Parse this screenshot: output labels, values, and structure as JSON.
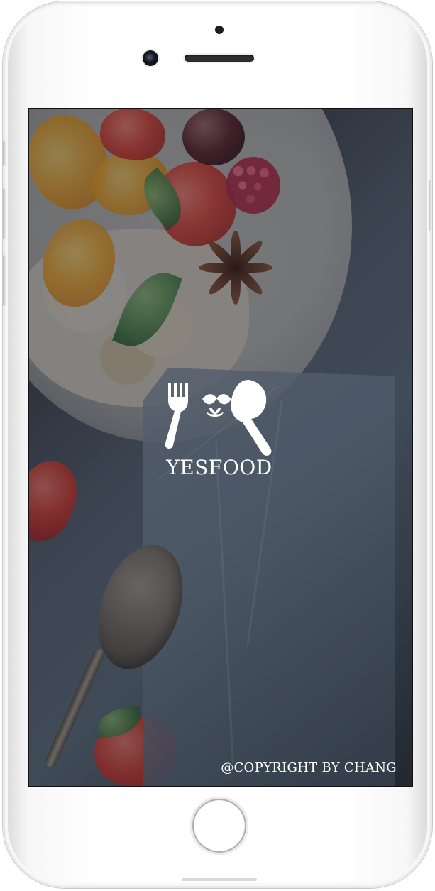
{
  "app": {
    "brand_name": "YESFOOD",
    "copyright": "@COPYRIGHT BY CHANG"
  },
  "device": {
    "model": "iPhone",
    "home_button_icon": "home-button-icon",
    "front_camera_icon": "camera-icon",
    "speaker_icon": "speaker-icon"
  },
  "visual": {
    "logo_icon": "panda-utensils-logo-icon",
    "background_description_icon": "food-photo-icon",
    "screen_overlay_color": "#14181d",
    "text_color": "#ffffff"
  }
}
